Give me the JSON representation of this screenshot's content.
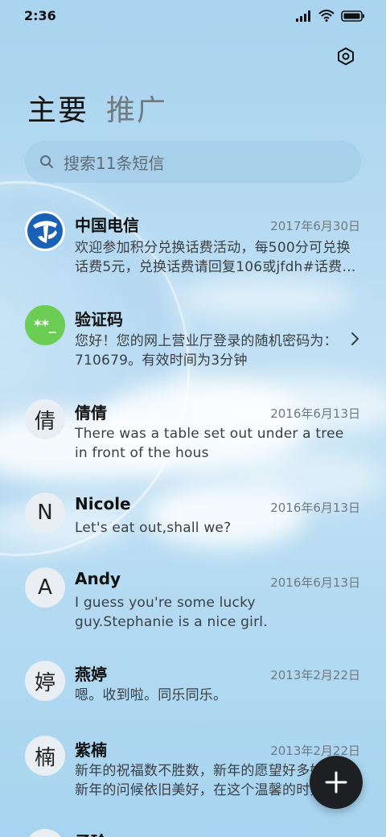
{
  "status_bar": {
    "time": "2:36",
    "icons": [
      "signal-icon",
      "wifi-icon",
      "battery-icon"
    ]
  },
  "settings": {
    "icon": "settings-icon"
  },
  "tabs": [
    {
      "label": "主要",
      "active": true
    },
    {
      "label": "推广",
      "active": false
    }
  ],
  "search": {
    "placeholder": "搜索11条短信",
    "icon": "search-icon"
  },
  "conversations": [
    {
      "name": "中国电信",
      "date": "2017年6月30日",
      "preview": "欢迎参加积分兑换话费活动，每500分可兑换话费5元，兑换话费请回复106或jfdh#话费…",
      "avatar": {
        "type": "logo",
        "icon": "china-telecom-logo-icon",
        "color": "#1a61b6"
      }
    },
    {
      "name": "验证码",
      "date": "",
      "preview": "您好！您的网上营业厅登录的随机密码为：710679。有效时间为3分钟",
      "avatar": {
        "type": "code",
        "text": "**_",
        "color": "#6ccd54"
      },
      "chevron": true
    },
    {
      "name": "倩倩",
      "date": "2016年6月13日",
      "preview": "There was a table set out under a tree in front of the hous",
      "avatar": {
        "type": "letter",
        "text": "倩"
      }
    },
    {
      "name": "Nicole",
      "date": "2016年6月13日",
      "preview": "Let's eat out,shall we?",
      "avatar": {
        "type": "letter",
        "text": "N"
      }
    },
    {
      "name": "Andy",
      "date": "2016年6月13日",
      "preview": "I guess you're some lucky guy.Stephanie is a nice girl.",
      "avatar": {
        "type": "letter",
        "text": "A"
      }
    },
    {
      "name": "燕婷",
      "date": "2013年2月22日",
      "preview": "嗯。收到啦。同乐同乐。",
      "avatar": {
        "type": "letter",
        "text": "婷"
      }
    },
    {
      "name": "紫楠",
      "date": "2013年2月22日",
      "preview": "新年的祝福数不胜数，新年的愿望好多好多，新年的问候依旧美好，在这个温馨的时刻…",
      "avatar": {
        "type": "letter",
        "text": "楠"
      }
    },
    {
      "name": "子玲",
      "date": "",
      "preview": "",
      "avatar": {
        "type": "letter",
        "text": "玲"
      }
    }
  ],
  "fab": {
    "icon": "plus-icon"
  }
}
